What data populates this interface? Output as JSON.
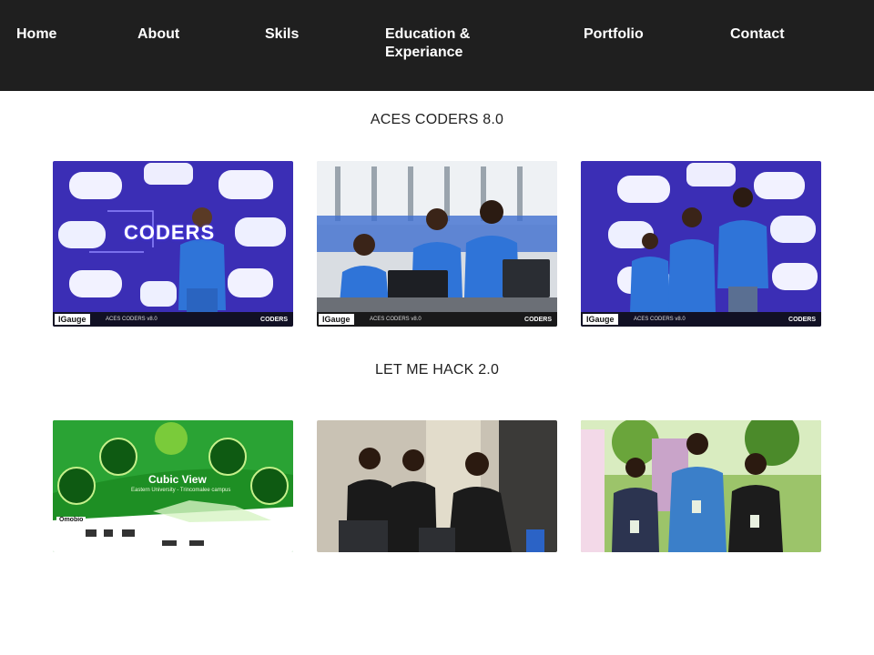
{
  "nav": {
    "home": "Home",
    "about": "About",
    "skils": "Skils",
    "education_line1": "Education &",
    "education_line2": "Experiance",
    "portfolio": "Portfolio",
    "contact": "Contact"
  },
  "sections": [
    {
      "title": "ACES CODERS 8.0",
      "caption": {
        "logo": "IGauge",
        "text": "ACES CODERS v8.0",
        "tag": "CODERS"
      },
      "overlay_word": "CODERS"
    },
    {
      "title": "LET ME HACK 2.0",
      "hack": {
        "title": "Cubic View",
        "subtitle": "Eastern University - Trincomalee campus",
        "brand": "Omobio"
      }
    }
  ],
  "colors": {
    "nav_bg": "#1f1f1f",
    "coders_bg": "#3c2fb8",
    "shirt_blue": "#2f74d8",
    "hack_green": "#1f9a2a"
  }
}
